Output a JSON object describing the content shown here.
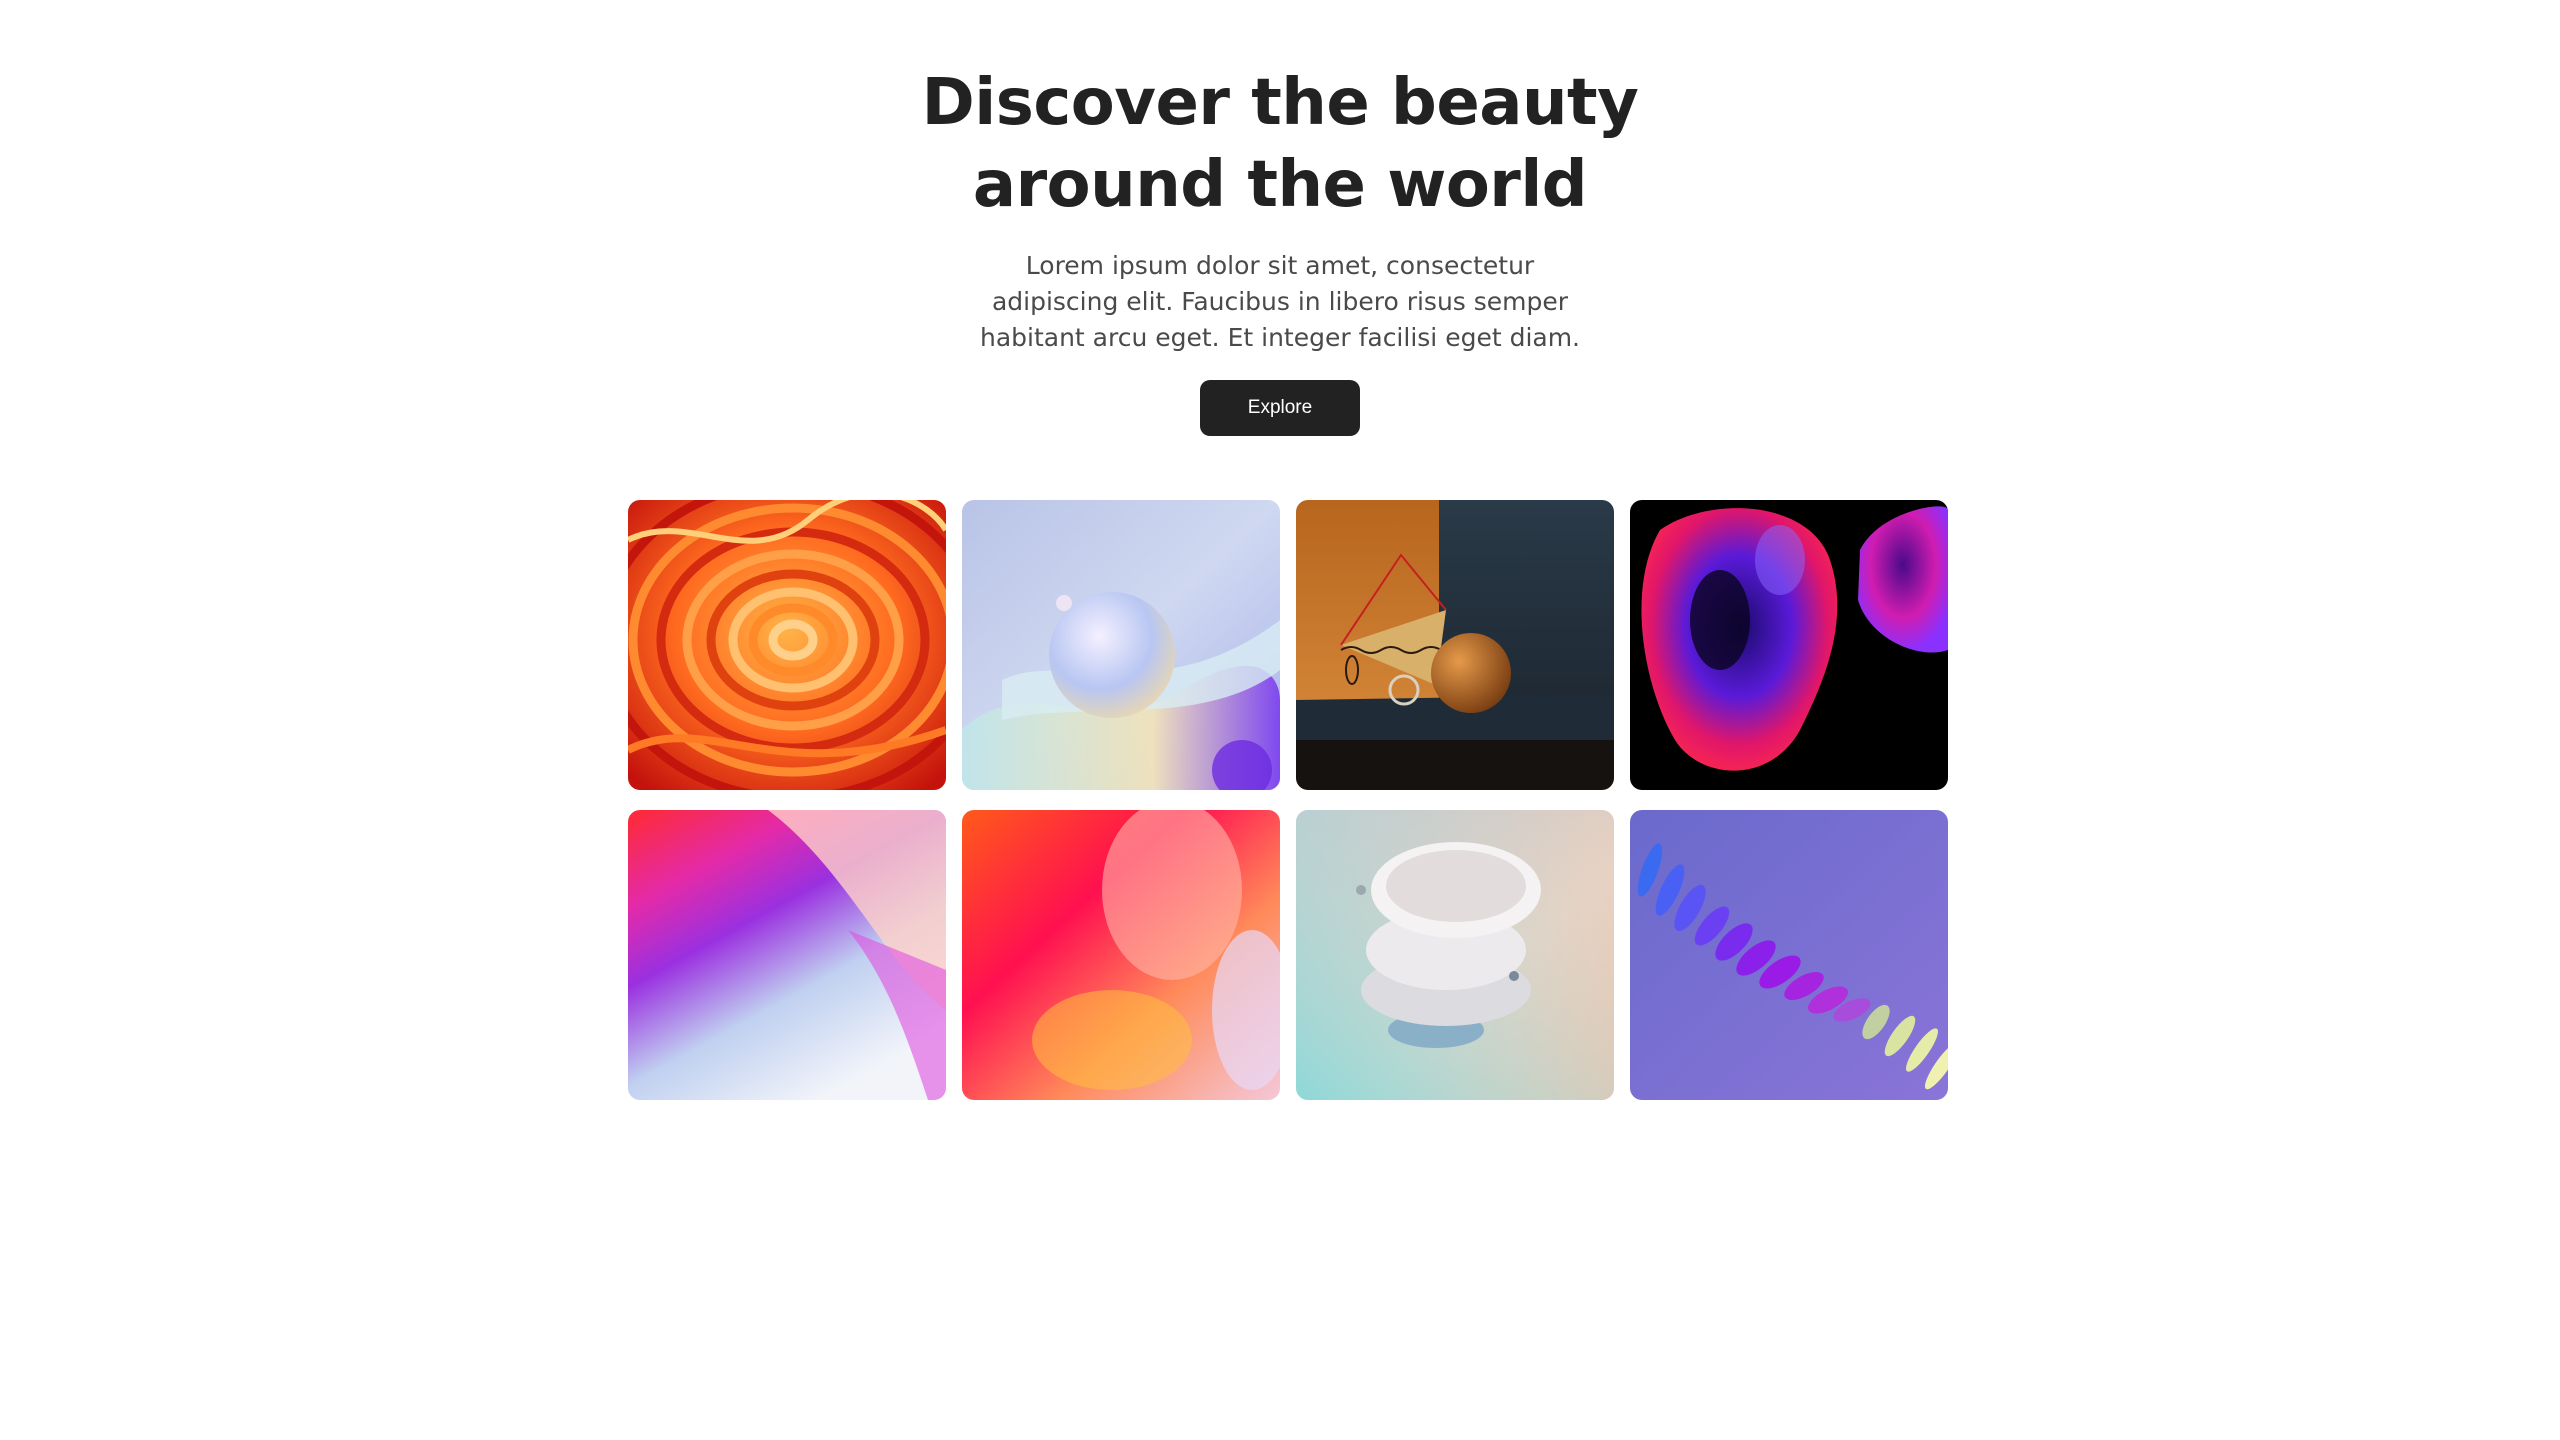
{
  "hero": {
    "title_line1": "Discover the beauty",
    "title_line2": "around the world",
    "description": "Lorem ipsum dolor sit amet, consectetur adipiscing elit. Faucibus in libero risus semper habitant arcu eget. Et integer facilisi eget diam.",
    "button_label": "Explore"
  },
  "colors": {
    "text": "#222222",
    "muted_text": "#4a4a4a",
    "button_bg": "#222222",
    "button_text": "#ffffff",
    "background": "#ffffff"
  },
  "gallery": {
    "items": [
      {
        "name": "orange-paper-swirl-image"
      },
      {
        "name": "pastel-sphere-image"
      },
      {
        "name": "orange-room-still-life-image"
      },
      {
        "name": "neon-blob-image"
      },
      {
        "name": "pink-purple-gradient-image"
      },
      {
        "name": "red-orange-blur-image"
      },
      {
        "name": "white-discs-sculpture-image"
      },
      {
        "name": "purple-spiral-ribbon-image"
      }
    ]
  }
}
